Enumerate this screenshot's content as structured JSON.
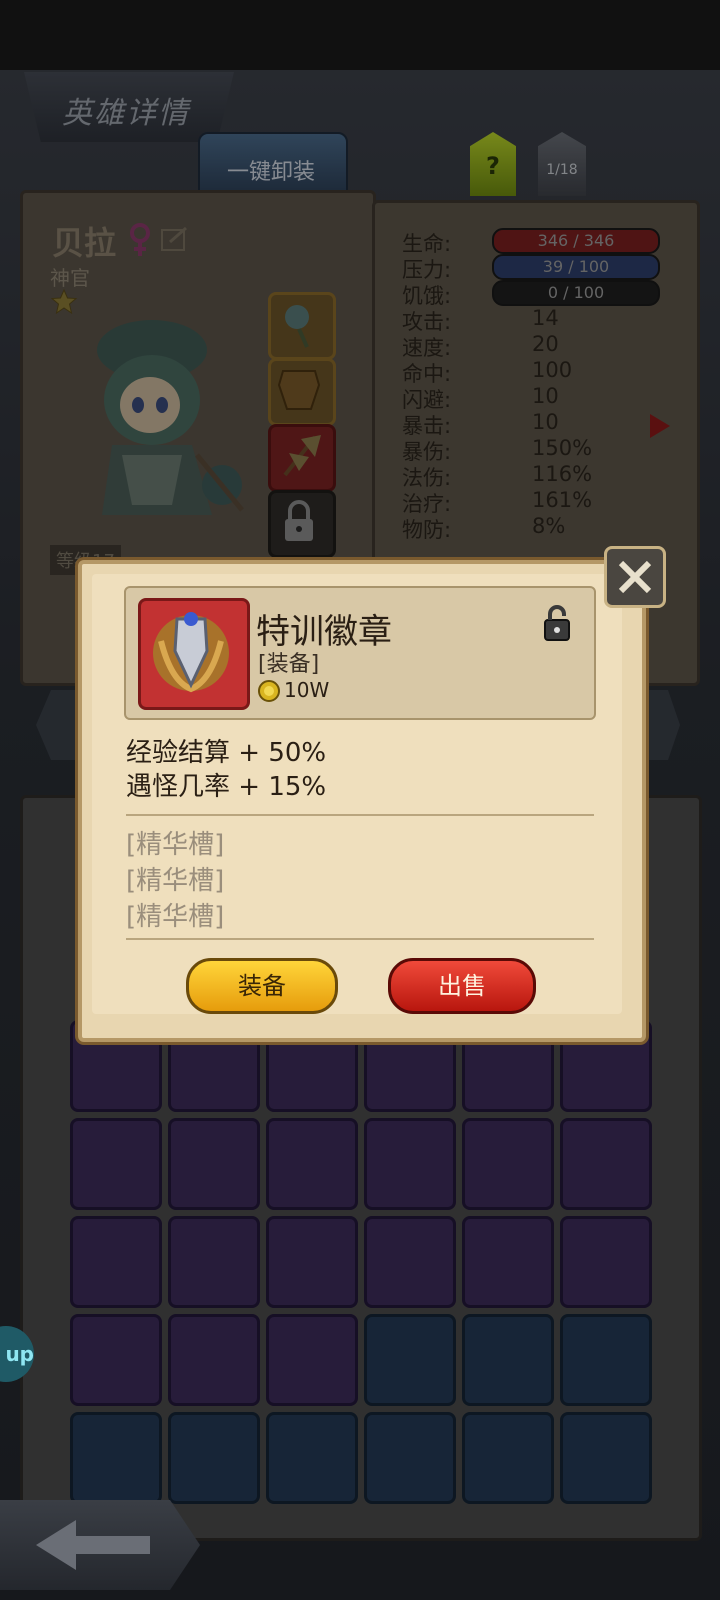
{
  "title": "英雄详情",
  "tabs": {
    "unequip_all": "一键卸装",
    "help": "?",
    "page": "1/18"
  },
  "hero": {
    "name": "贝拉",
    "class": "神官",
    "level": "等级17",
    "stars": 1
  },
  "stats": {
    "hp": {
      "label": "生命:",
      "value": "346 / 346"
    },
    "pressure": {
      "label": "压力:",
      "value": "39 / 100"
    },
    "hunger": {
      "label": "饥饿:",
      "value": "0 / 100"
    },
    "rows": [
      {
        "label": "攻击:",
        "value": "14"
      },
      {
        "label": "速度:",
        "value": "20"
      },
      {
        "label": "命中:",
        "value": "100"
      },
      {
        "label": "闪避:",
        "value": "10"
      },
      {
        "label": "暴击:",
        "value": "10"
      },
      {
        "label": "暴伤:",
        "value": "150%"
      },
      {
        "label": "法伤:",
        "value": "116%"
      },
      {
        "label": "治疗:",
        "value": "161%"
      },
      {
        "label": "物防:",
        "value": "8%"
      }
    ]
  },
  "popup": {
    "item_name": "特训徽章",
    "item_type": "[装备]",
    "price": "10W",
    "attributes": [
      "经验结算 + 50%",
      "遇怪几率 + 15%"
    ],
    "slots": [
      "[精华槽]",
      "[精华槽]",
      "[精华槽]"
    ],
    "equip_label": "装备",
    "sell_label": "出售"
  },
  "float_button": "up",
  "colors": {
    "hp": "#7a2020",
    "pressure": "#2d3e6a",
    "equip": "#f2b21c",
    "sell": "#d62a1e"
  }
}
